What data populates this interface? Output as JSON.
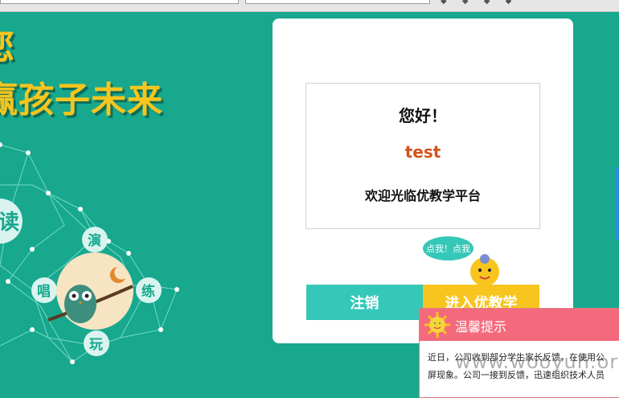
{
  "slogans": {
    "line1": "您",
    "line2": "赢孩子未来"
  },
  "network_labels": {
    "read": "读",
    "act": "演",
    "sing": "唱",
    "practice": "练",
    "play": "玩"
  },
  "card": {
    "hello": "您好！",
    "username": "test",
    "welcome": "欢迎光临优教学平台",
    "logout_label": "注销",
    "enter_label": "进入优教学"
  },
  "mascot": {
    "bubble_text": "点我！点我"
  },
  "popup": {
    "title": "温馨提示",
    "line1": "近日，公司收到部分学生家长反馈，在使用公",
    "line2": "屏现象。公司一接到反馈，迅速组织技术人员"
  },
  "watermark": "www.wooyun.org",
  "colors": {
    "background": "#17a88e",
    "accent_teal": "#35c7b7",
    "accent_yellow": "#f7c51e",
    "popup_header": "#f36a7c",
    "username": "#d4531c"
  }
}
